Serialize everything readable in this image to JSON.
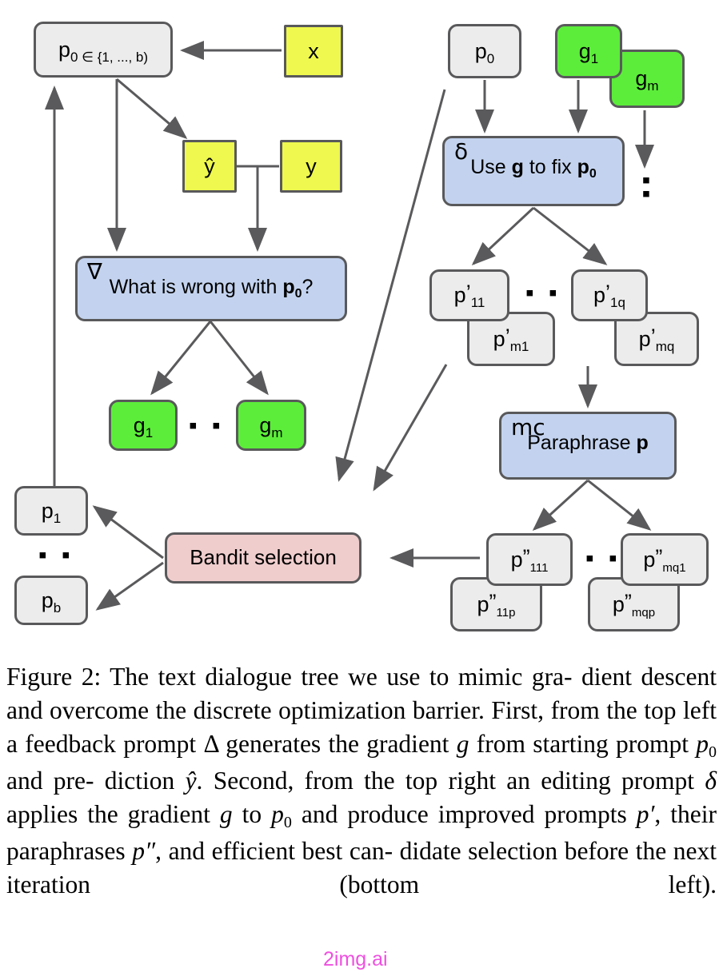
{
  "figure": {
    "nodes": {
      "p0_bandit": {
        "label": "p",
        "sub": "0 ∈ {1, ..., b)"
      },
      "x": {
        "label": "x"
      },
      "yhat": {
        "label": "ŷ"
      },
      "y": {
        "label": "y"
      },
      "feedback": {
        "symbol": "∇",
        "text": "What is wrong with ",
        "bold": "p",
        "bold_sub": "0",
        "suffix": "?"
      },
      "g1_left": {
        "label": "g",
        "sub": "1"
      },
      "gm_left": {
        "label": "g",
        "sub": "m"
      },
      "p1": {
        "label": "p",
        "sub": "1"
      },
      "pb": {
        "label": "p",
        "sub": "b"
      },
      "bandit": {
        "label": "Bandit selection"
      },
      "p0_right": {
        "label": "p",
        "sub": "0"
      },
      "g1_right": {
        "label": "g",
        "sub": "1"
      },
      "gm_right": {
        "label": "g",
        "sub": "m"
      },
      "edit": {
        "symbol": "δ",
        "text": "Use ",
        "bold_g": "g",
        "mid": " to fix ",
        "bold": "p",
        "bold_sub": "0"
      },
      "pp_11": {
        "label": "p",
        "prime": "’",
        "sub": "11"
      },
      "pp_m1": {
        "label": "p",
        "prime": "’",
        "sub": "m1"
      },
      "pp_1q": {
        "label": "p",
        "prime": "’",
        "sub": "1q"
      },
      "pp_mq": {
        "label": "p",
        "prime": "’",
        "sub": "mq"
      },
      "paraphrase": {
        "symbol": "mc",
        "text": "Paraphrase ",
        "bold": "p"
      },
      "ppp_111": {
        "label": "p",
        "prime": "”",
        "sub": "111"
      },
      "ppp_11p": {
        "label": "p",
        "prime": "”",
        "sub": "11p"
      },
      "ppp_mq1": {
        "label": "p",
        "prime": "”",
        "sub": "mq1"
      },
      "ppp_mqp": {
        "label": "p",
        "prime": "”",
        "sub": "mqp"
      }
    },
    "ellipses": {
      "g_left": "▪ ▪",
      "pb_left": "▪ ▪",
      "pp_mid": "▪ ▪",
      "ppp_mid": "▪ ▪",
      "gm_vertical": "▪\n▪"
    },
    "colors": {
      "grey": "#ececec",
      "yellow": "#eef84e",
      "green": "#5ced3a",
      "blue": "#c3d3ef",
      "pink": "#f0cdcd",
      "stroke": "#59595b",
      "arrow": "#5a5a5c"
    }
  },
  "caption": {
    "prefix": "Figure 2:",
    "line1": " The text dialogue tree we use to mimic gra-",
    "line2": "dient descent and overcome the discrete optimization",
    "line3a": "barrier.  First, from the top left a feedback prompt ",
    "line3b": "Δ",
    "line4a": "generates the gradient ",
    "line4b": "g",
    "line4c": " from starting prompt ",
    "line4d": "p",
    "line4e": "0",
    "line4f": " and pre-",
    "line5a": "diction ",
    "line5b": "ŷ",
    "line5c": ". Second, from the top right an editing prompt",
    "line6a": "δ",
    "line6b": " applies the gradient ",
    "line6c": "g",
    "line6d": " to ",
    "line6e": "p",
    "line6f": "0",
    "line6g": " and produce improved",
    "line7a": "prompts ",
    "line7b": "p′",
    "line7c": ", their paraphrases ",
    "line7d": "p″",
    "line7e": ", and efficient best can-",
    "line8": "didate selection before the next iteration (bottom left)."
  },
  "watermark": {
    "text": "2img.ai",
    "color": "#ef4fe0"
  }
}
